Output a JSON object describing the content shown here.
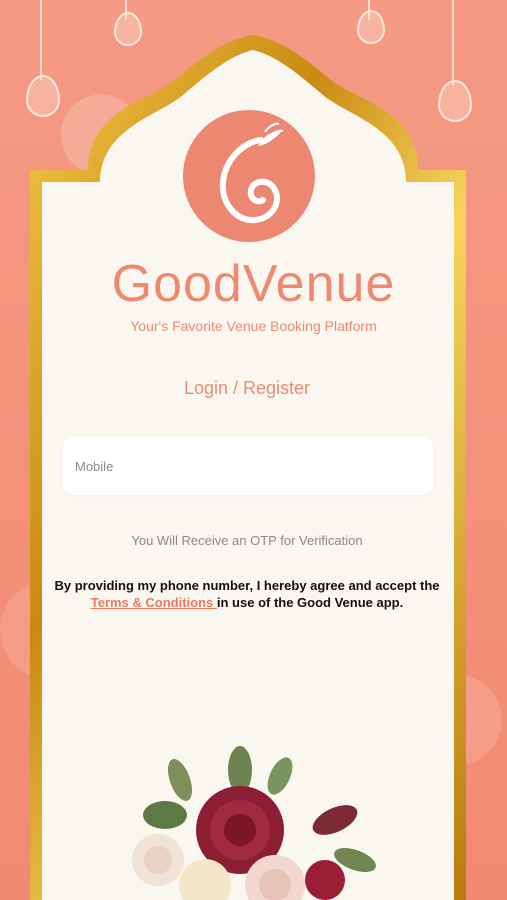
{
  "brand": {
    "name": "GoodVenue",
    "tagline": "Your's Favorite Venue Booking Platform"
  },
  "login": {
    "title": "Login / Register",
    "mobile_placeholder": "Mobile",
    "otp_note": "You Will Receive an OTP for Verification"
  },
  "consent": {
    "prefix": "By providing my phone number, I hereby agree and accept the",
    "link_text": " Terms & Conditions ",
    "suffix": " in use of the Good Venue app."
  },
  "colors": {
    "accent": "#ee8a72",
    "background": "#f4937b",
    "card": "#faf7f1",
    "frame_gold": "#d9a520"
  },
  "icons": {
    "logo": "swirl-leaf-logo-icon",
    "decoration": "flower-bouquet"
  }
}
